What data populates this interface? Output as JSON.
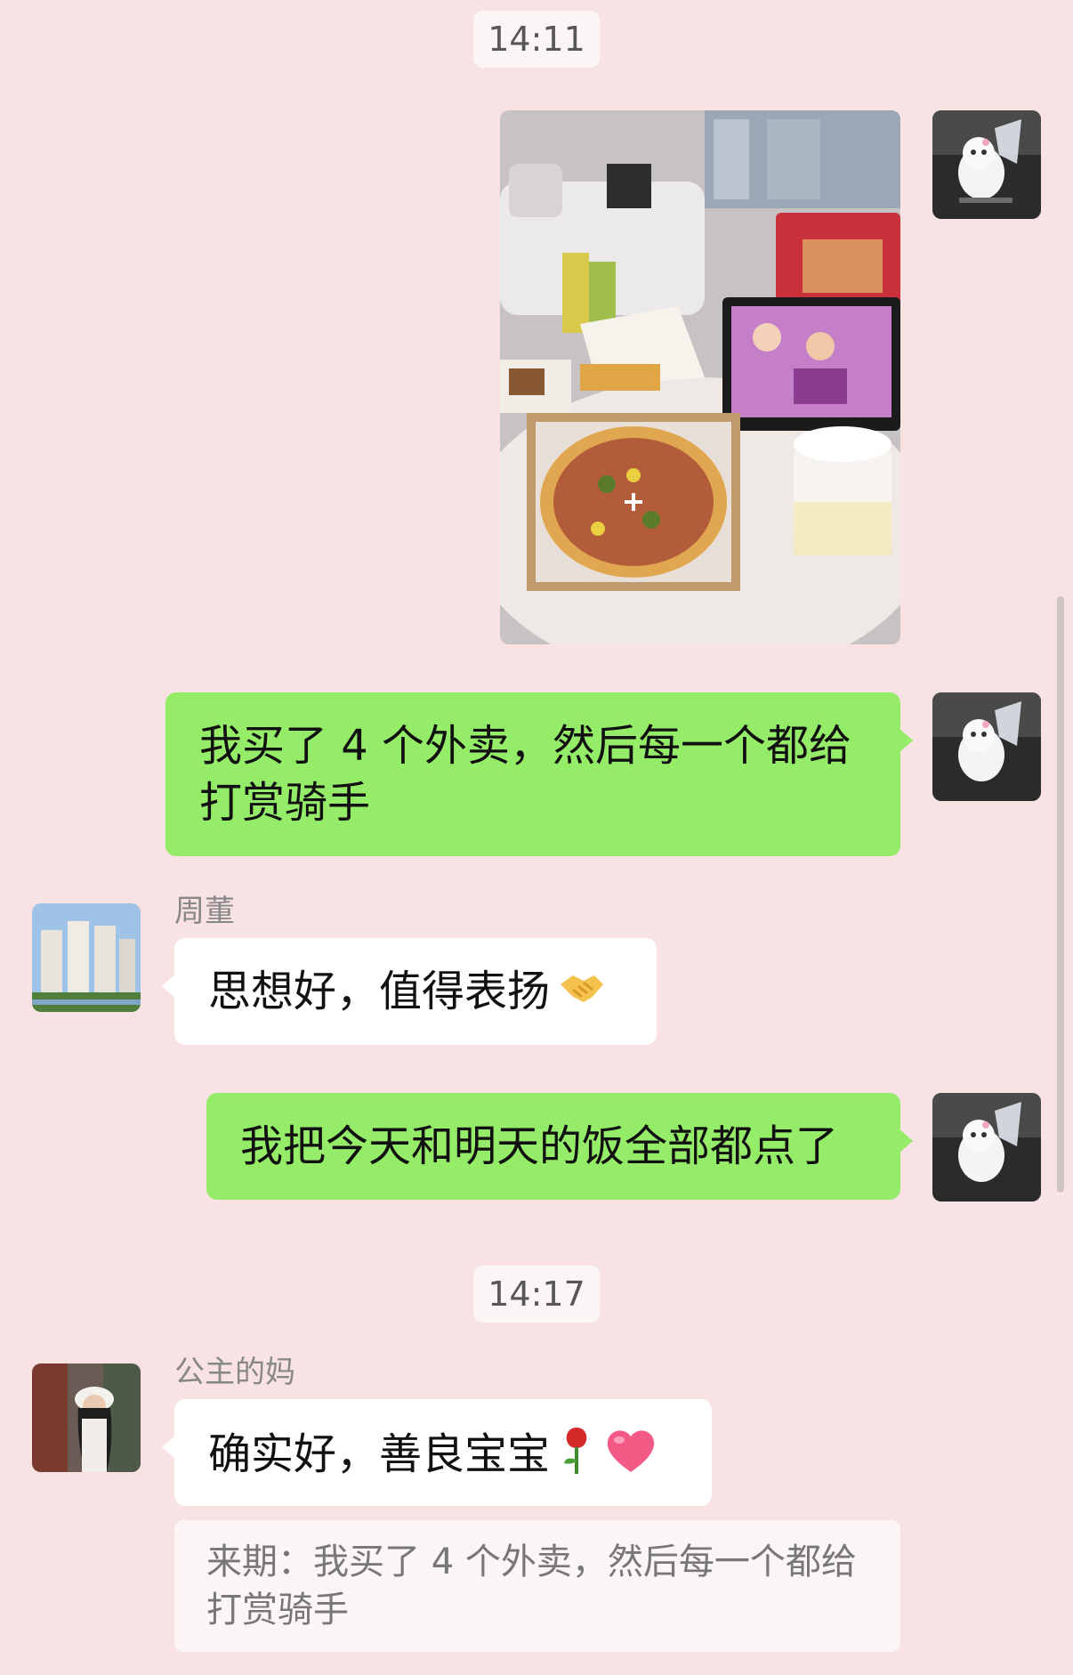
{
  "timestamps": [
    "14:11",
    "14:17"
  ],
  "messages": [
    {
      "id": "m1",
      "from": "me",
      "kind": "image",
      "image_desc": "food-photo"
    },
    {
      "id": "m2",
      "from": "me",
      "kind": "text",
      "line1": "我买了 4 个外卖，然后每一个都给",
      "line2": "打赏骑手"
    },
    {
      "id": "m3",
      "from": "other",
      "sender": "周董",
      "kind": "text",
      "text": "思想好，值得表扬",
      "emoji": "handshake-emoji"
    },
    {
      "id": "m4",
      "from": "me",
      "kind": "text",
      "text": "我把今天和明天的饭全部都点了"
    },
    {
      "id": "m5",
      "from": "other",
      "sender": "公主的妈",
      "kind": "text",
      "text": "确实好，善良宝宝",
      "emoji": [
        "rose-emoji",
        "heart-emoji"
      ],
      "quote": {
        "line1": "来期：我买了 4 个外卖，然后每一个都给",
        "line2": "打赏骑手"
      }
    }
  ],
  "avatars": {
    "me": "white-cat-avatar",
    "zhoudong": "building-avatar",
    "gongzhu_ma": "woman-photo-avatar"
  },
  "colors": {
    "background": "#f9e2e4",
    "my_bubble": "#95ec69",
    "their_bubble": "#ffffff",
    "timestamp_bg": "#fcf5f6"
  }
}
